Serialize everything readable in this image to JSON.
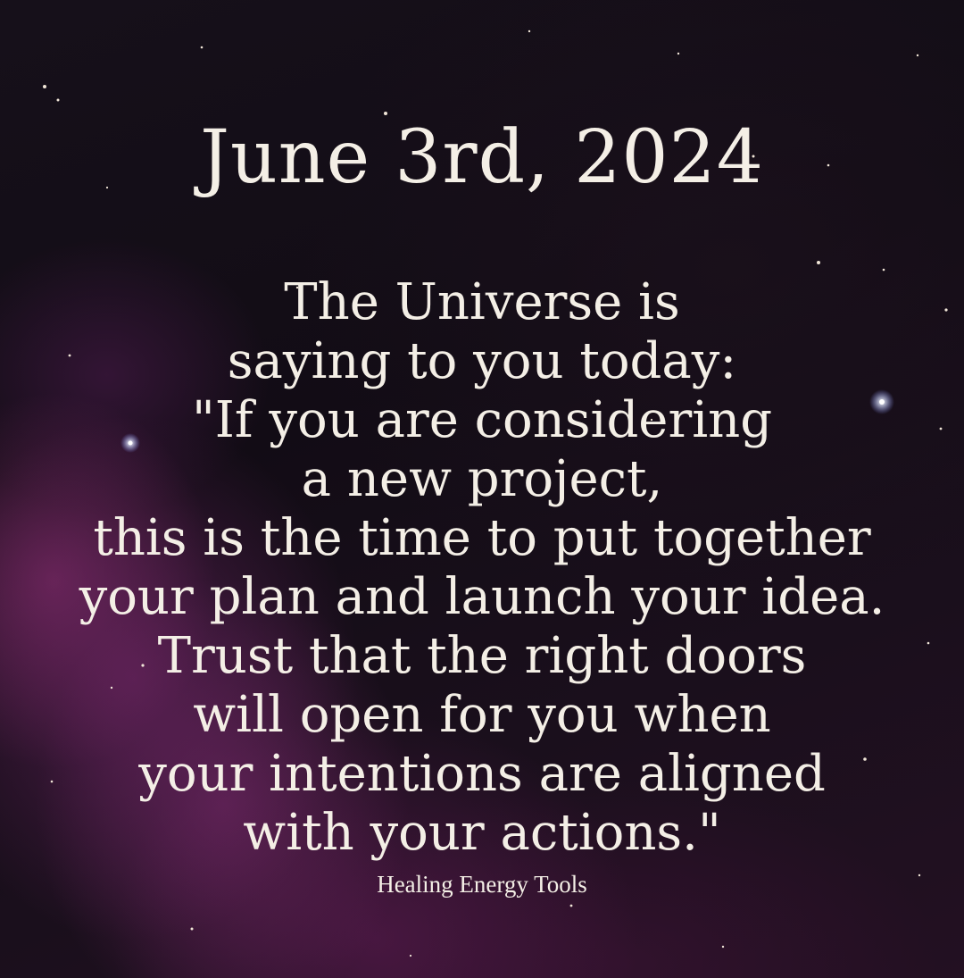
{
  "date": "June 3rd, 2024",
  "message": {
    "lines": [
      "The Universe is",
      "saying to you today:",
      "\"If you are considering",
      "a new project,",
      "this is the time to put together",
      "your plan and launch your idea.",
      "Trust that the right doors",
      "will open for you when",
      "your intentions are aligned",
      "with your actions.\""
    ]
  },
  "credit": "Healing Energy Tools",
  "colors": {
    "text": "#f4efe6",
    "background": "#130d16",
    "nebula": "#a83c8c"
  }
}
